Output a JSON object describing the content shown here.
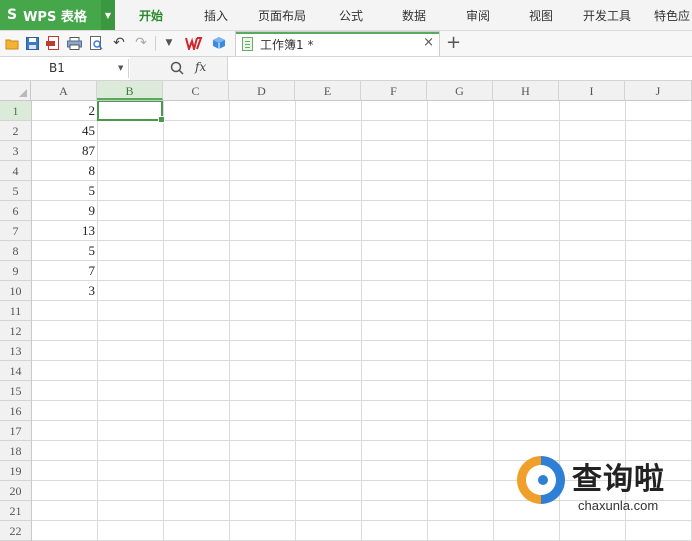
{
  "app": {
    "logo": "S",
    "name": "WPS 表格",
    "brand_color": "#46a64a"
  },
  "menu": {
    "items": [
      {
        "label": "开始",
        "active": true
      },
      {
        "label": "插入"
      },
      {
        "label": "页面布局"
      },
      {
        "label": "公式"
      },
      {
        "label": "数据"
      },
      {
        "label": "审阅"
      },
      {
        "label": "视图"
      },
      {
        "label": "开发工具"
      },
      {
        "label": "特色应"
      }
    ]
  },
  "toolbar": {
    "icons": [
      "open-folder-icon",
      "save-icon",
      "export-pdf-icon",
      "print-icon",
      "print-preview-icon",
      "undo-icon",
      "redo-icon",
      "dropdown-icon",
      "wps-logo-icon",
      "cloud-cube-icon"
    ]
  },
  "document_tab": {
    "title": "工作簿1 *",
    "close": "×",
    "new_tab": "+"
  },
  "formula_bar": {
    "name_box": "B1",
    "fx": "fx",
    "formula": ""
  },
  "sheet": {
    "selected_cell": "B1",
    "columns": [
      "A",
      "B",
      "C",
      "D",
      "E",
      "F",
      "G",
      "H",
      "I",
      "J"
    ],
    "rows": [
      "1",
      "2",
      "3",
      "4",
      "5",
      "6",
      "7",
      "8",
      "9",
      "10",
      "11",
      "12",
      "13",
      "14",
      "15",
      "16",
      "17",
      "18",
      "19",
      "20",
      "21",
      "22"
    ],
    "column_a_values": [
      "2",
      "45",
      "87",
      "8",
      "5",
      "9",
      "13",
      "5",
      "7",
      "3"
    ]
  },
  "watermark": {
    "title": "查询啦",
    "subtitle": "chaxunla.com"
  }
}
